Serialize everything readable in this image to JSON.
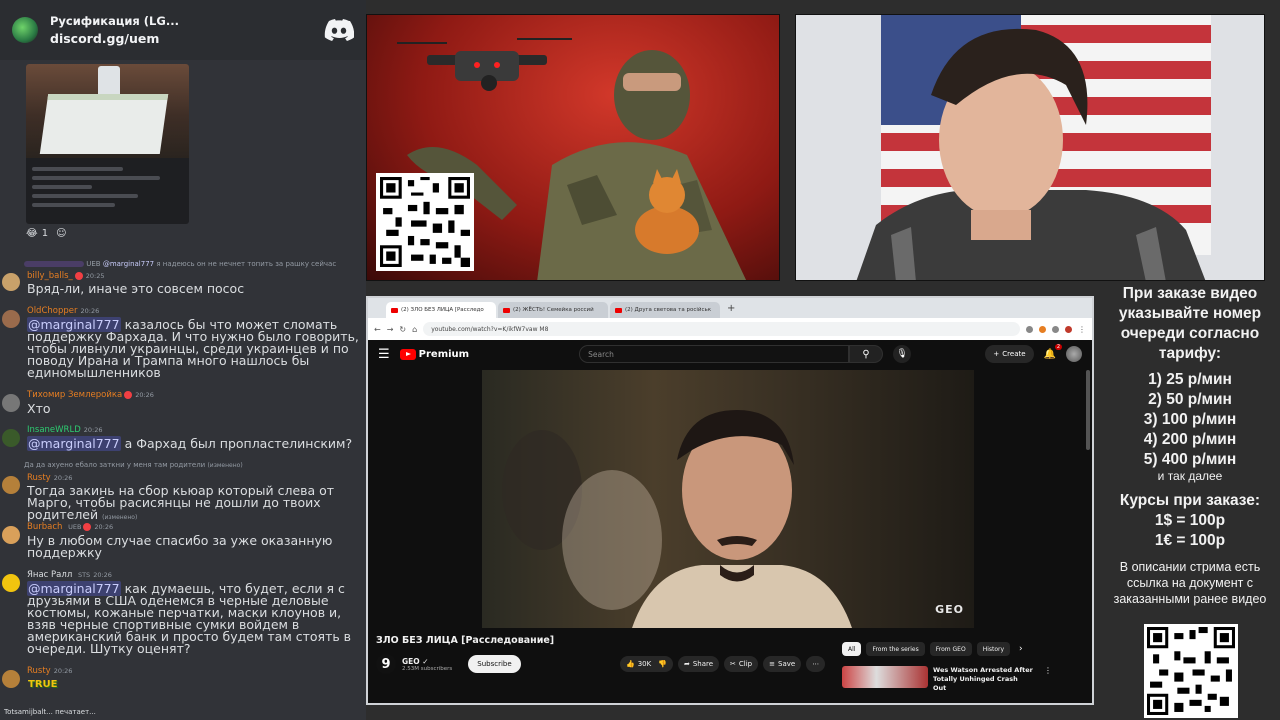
{
  "chat": {
    "server_title": "Русификация (LG...",
    "invite": "discord.gg/uem",
    "reactions": [
      {
        "emoji": "😂",
        "count": "1"
      },
      {
        "emoji": "☺",
        "count": ""
      }
    ],
    "messages": [
      {
        "reply_badge": "UEB",
        "reply_mention": "@marginal777",
        "reply_text": "я надеюсь он не нечнет топить за рашку сейчас",
        "user": "billy_balls_",
        "user_color": "#e67e22",
        "time": "20:25",
        "text": "Вряд-ли, иначе это совсем посос"
      },
      {
        "user": "OldChopper",
        "user_color": "#e67e22",
        "time": "20:26",
        "mention": "@marginal777",
        "text": "казалось бы что может сломать поддержку Фархада. И что нужно было говорить, чтобы ливнули украинцы, среди украинцев и по поводу Ирана и Трампа много нашлось бы единомышленников"
      },
      {
        "user": "Тихомир Землеройка",
        "user_color": "#e67e22",
        "time": "20:26",
        "text": "Хто"
      },
      {
        "user": "InsaneWRLD",
        "user_color": "#2ecc71",
        "time": "20:26",
        "mention": "@marginal777",
        "text": "а Фархад был пропластелинским?"
      },
      {
        "reply_text": "Да да ахуено ебало заткни у меня там родители",
        "reply_edited": "(изменено)",
        "user": "Rusty",
        "user_color": "#e67e22",
        "time": "20:26",
        "text": "Тогда закинь на сбор кьюар который слева от Марго, чтобы расисянцы не дошли до твоих родителей",
        "edited": "(изменено)"
      },
      {
        "user": "Burbach",
        "user_color": "#e67e22",
        "badge": "UEB",
        "time": "20:26",
        "text": "Ну в любом случае спасибо за уже оказанную поддержку"
      },
      {
        "user": "Янас Ралл",
        "user_color": "#dbdee1",
        "badge": "STS",
        "time": "20:26",
        "mention": "@marginal777",
        "text": "как думаешь, что будет, если я с друзьями в США оденемся в черные деловые костюмы, кожаные перчатки, маски клоунов и, взяв черные спортивные сумки войдем в американский банк и просто будем там стоять в очереди. Шутку оценят?"
      },
      {
        "user": "Rusty",
        "user_color": "#e67e22",
        "time": "20:26",
        "text": ""
      }
    ],
    "sticker_text": "TRUE",
    "typing": "Totsamijbalt... печатает..."
  },
  "browser": {
    "tabs": [
      {
        "label": "(2) ЗЛО БЕЗ ЛИЦА [Расследо",
        "active": true
      },
      {
        "label": "(2) ЖЁСТЬ! Семейка россий",
        "active": false
      },
      {
        "label": "(2) Друга светова та російськ",
        "active": false
      }
    ],
    "url": "youtube.com/watch?v=K/ikfW7vaw M8"
  },
  "youtube": {
    "logo": "Premium",
    "search_placeholder": "Search",
    "create": "Create",
    "notif_count": "2",
    "watermark": "GEO",
    "title": "ЗЛО БЕЗ ЛИЦА [Расследование]",
    "channel": "GEO",
    "channel_letter": "9",
    "subscribers": "2.53M subscribers",
    "subscribe": "Subscribe",
    "likes": "30K",
    "share": "Share",
    "clip": "Clip",
    "save": "Save",
    "chips": [
      "All",
      "From the series",
      "From GEO",
      "History"
    ],
    "rec_title": "Wes Watson Arrested After Totally Unhinged Crash Out"
  },
  "info": {
    "head": "При заказе видео указывайте номер очереди согласно тарифу:",
    "tariffs": [
      "1) 25 р/мин",
      "2) 50 р/мин",
      "3) 100 р/мин",
      "4) 200 р/мин",
      "5) 400 р/мин"
    ],
    "etc": "и так далее",
    "courses_head": "Курсы при заказе:",
    "rates": [
      "1$ = 100р",
      "1€ = 100р"
    ],
    "note": "В описании стрима есть ссылка на документ с заказанными ранее видео"
  },
  "colors": {
    "chat_bg": "#313338",
    "mention": "#c9cdfb",
    "yt_red": "#ff0000",
    "poster_red": "#c0281e"
  }
}
